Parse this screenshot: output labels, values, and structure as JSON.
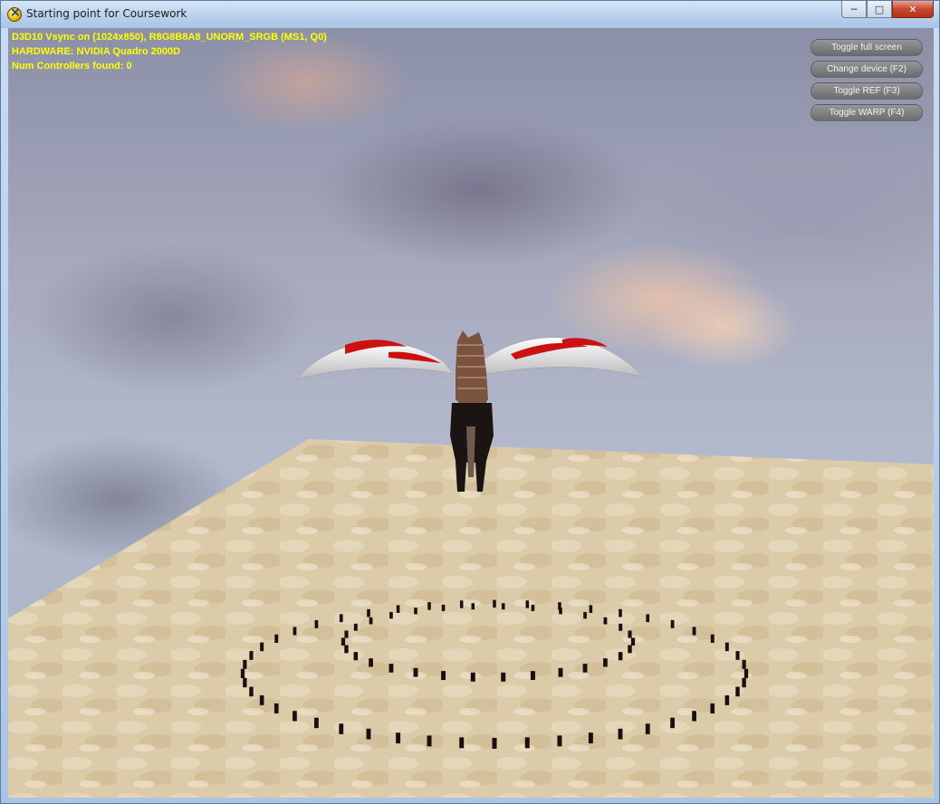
{
  "window": {
    "title": "Starting point for Coursework",
    "icon": "directx-app-icon",
    "controls": {
      "minimize": "─",
      "maximize": "□",
      "close": "✕"
    }
  },
  "hud": {
    "lines": [
      "D3D10 Vsync on (1024x850), R8G8B8A8_UNORM_SRGB (MS1, Q0)",
      "HARDWARE: NVIDIA Quadro 2000D",
      "Num Controllers found: 0"
    ],
    "color": "#ffff00"
  },
  "buttons": {
    "toggle_full_screen": "Toggle full screen",
    "change_device": "Change device (F2)",
    "toggle_ref": "Toggle REF (F3)",
    "toggle_warp": "Toggle WARP (F4)"
  },
  "colors": {
    "hud_text": "#ffff00",
    "ground": "#d9c8a4",
    "wing_trim": "#cc1111",
    "horse_body": "#1a1412"
  }
}
